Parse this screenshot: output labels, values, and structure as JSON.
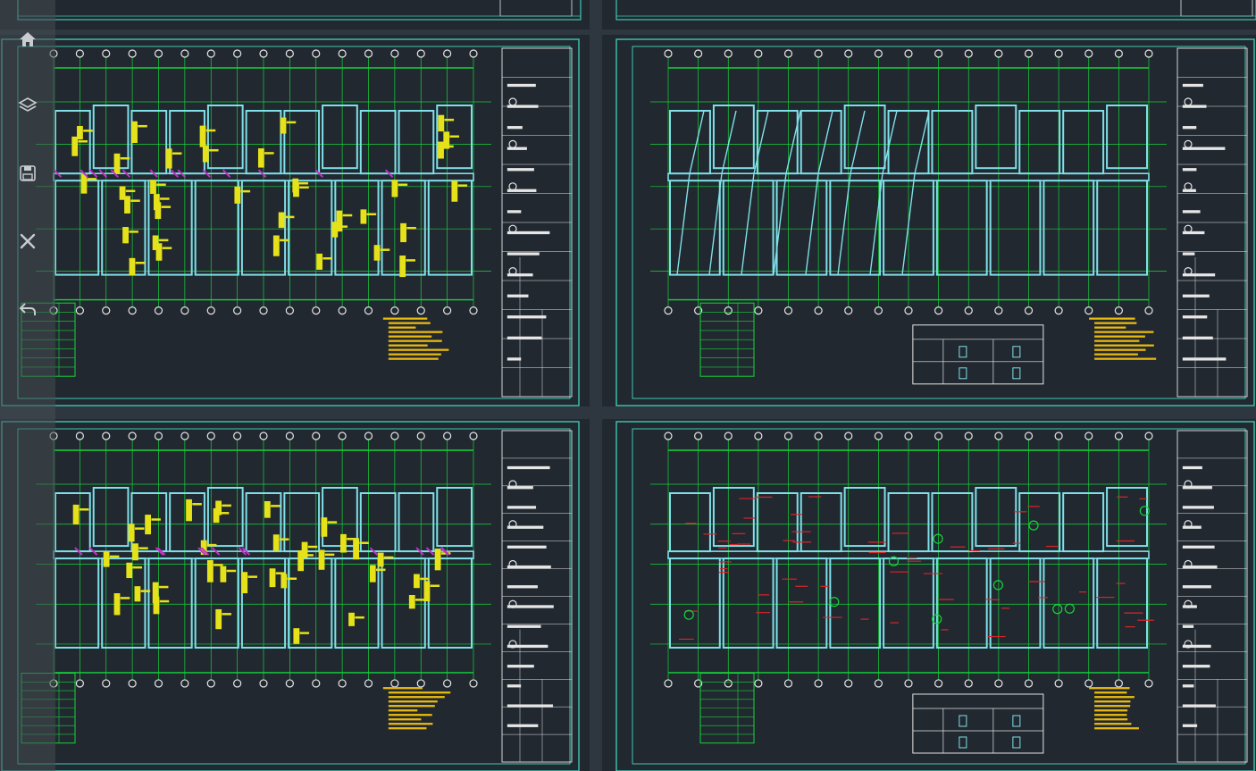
{
  "colors": {
    "background": "#212830",
    "frame": "#3fc7b2",
    "grid": "#16d43a",
    "wall": "#7fe0e8",
    "column": "#e6e21a",
    "text_yellow": "#e8b90f",
    "magenta": "#c032c8",
    "red": "#d8262a",
    "white": "#e6e6e6"
  },
  "sidebar": {
    "items": [
      {
        "icon": "home-icon",
        "label": "",
        "active": false
      },
      {
        "icon": "layers-icon",
        "label": "",
        "active": false
      },
      {
        "icon": "save-icon",
        "label": "",
        "active": true
      },
      {
        "icon": "tools-icon",
        "label": "",
        "active": false
      },
      {
        "icon": "undo-icon",
        "label": "",
        "active": false
      }
    ]
  },
  "sheets": [
    {
      "name": "top-left",
      "variant": "yellow-tags"
    },
    {
      "name": "top-right",
      "variant": "cyan-beams",
      "has_table": true
    },
    {
      "name": "bottom-left",
      "variant": "yellow-tags"
    },
    {
      "name": "bottom-right",
      "variant": "red-rebar",
      "has_table": true
    }
  ]
}
